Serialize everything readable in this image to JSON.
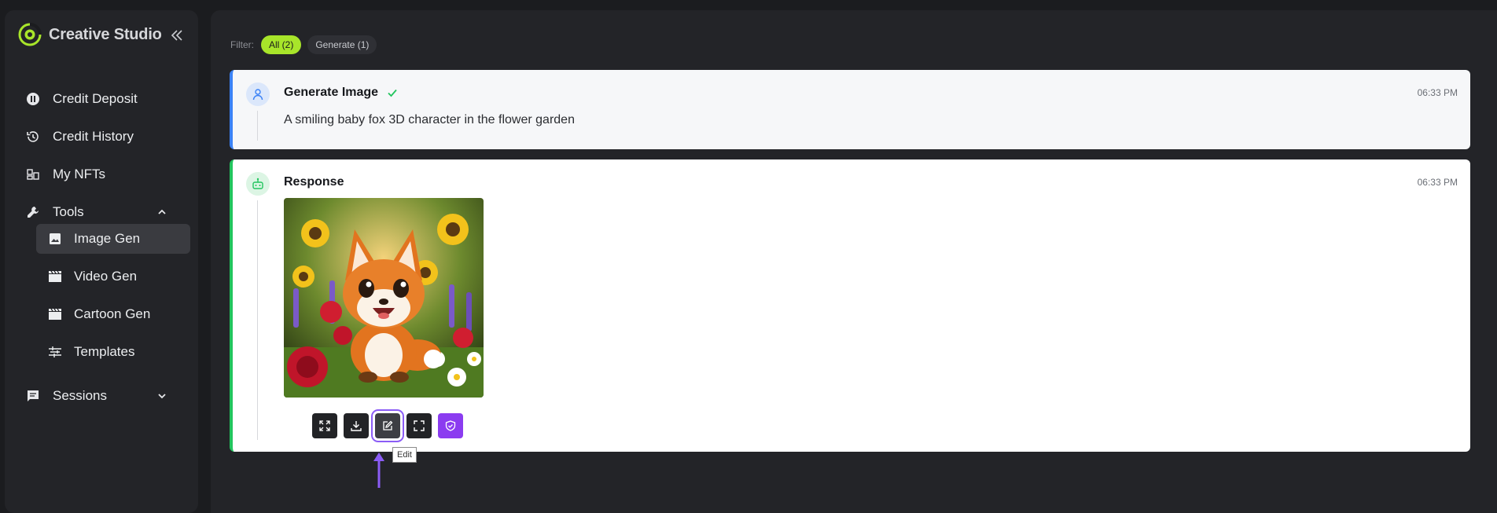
{
  "sidebar": {
    "brand": {
      "title": "Creative Studio",
      "accent": "#a8e52a"
    },
    "items": [
      {
        "label": "Credit Deposit",
        "icon": "pause-circle-icon"
      },
      {
        "label": "Credit History",
        "icon": "history-icon"
      },
      {
        "label": "My NFTs",
        "icon": "nft-icon"
      },
      {
        "label": "Tools",
        "icon": "wrench-icon",
        "expanded": true,
        "children": [
          {
            "label": "Image Gen",
            "icon": "image-icon",
            "active": true
          },
          {
            "label": "Video Gen",
            "icon": "clapperboard-icon"
          },
          {
            "label": "Cartoon Gen",
            "icon": "clapperboard-icon"
          },
          {
            "label": "Templates",
            "icon": "layers-icon"
          }
        ]
      },
      {
        "label": "Sessions",
        "icon": "chat-icon",
        "expanded": false
      }
    ]
  },
  "filter": {
    "label": "Filter:",
    "chips": [
      {
        "label": "All (2)",
        "active": true
      },
      {
        "label": "Generate (1)",
        "active": false
      }
    ]
  },
  "request": {
    "title": "Generate Image",
    "status": "completed",
    "time": "06:33 PM",
    "prompt": "A smiling baby fox 3D character in the flower garden",
    "accent": "#3b82f6"
  },
  "response": {
    "title": "Response",
    "time": "06:33 PM",
    "accent": "#22c55e",
    "image_alt": "baby fox in flower garden",
    "toolbar": [
      {
        "name": "expand-icon",
        "tooltip": ""
      },
      {
        "name": "download-icon",
        "tooltip": ""
      },
      {
        "name": "edit-icon",
        "tooltip": "Edit",
        "active": true
      },
      {
        "name": "fullscreen-icon",
        "tooltip": ""
      },
      {
        "name": "shield-icon",
        "tooltip": ""
      }
    ],
    "tooltip": "Edit"
  }
}
